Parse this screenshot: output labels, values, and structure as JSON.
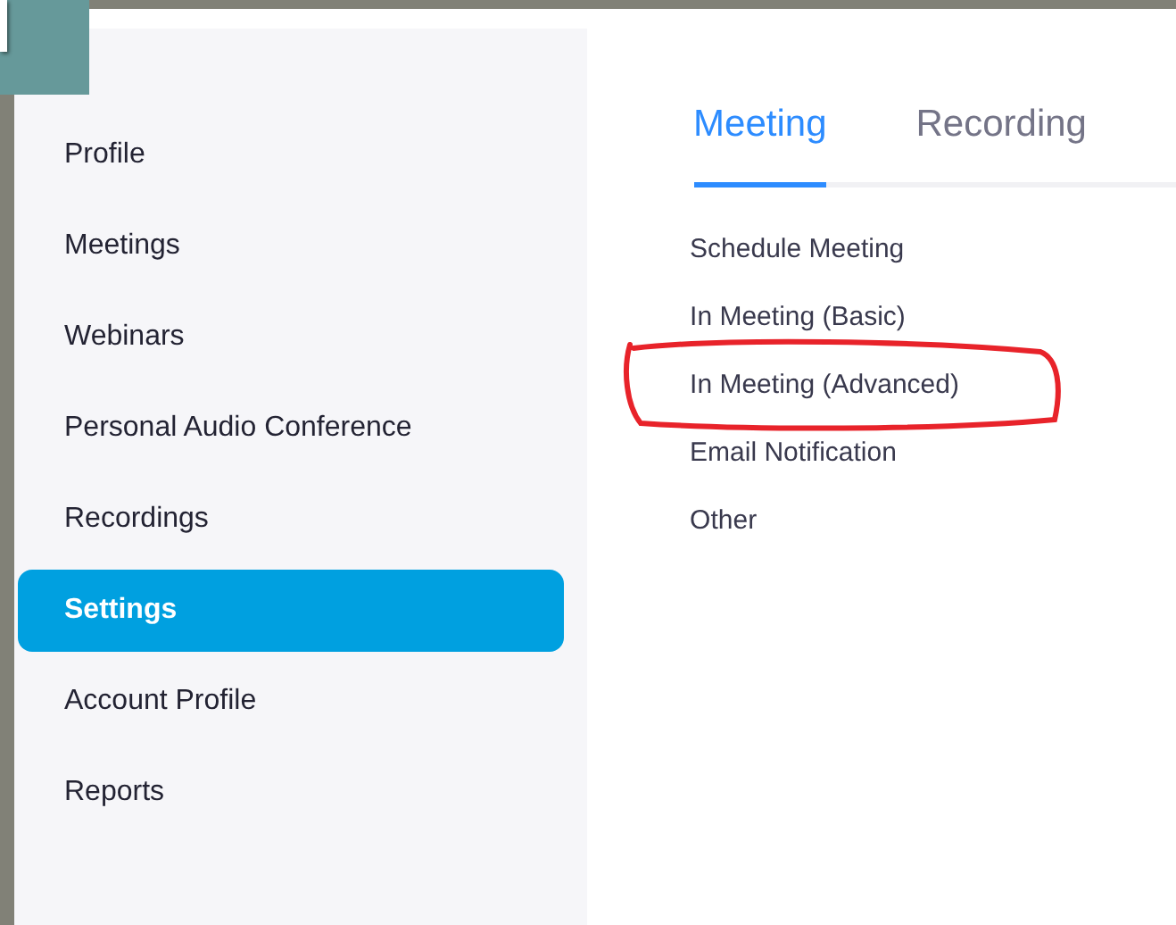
{
  "sidebar": {
    "items": [
      {
        "label": "Profile",
        "selected": false
      },
      {
        "label": "Meetings",
        "selected": false
      },
      {
        "label": "Webinars",
        "selected": false
      },
      {
        "label": "Personal Audio Conference",
        "selected": false
      },
      {
        "label": "Recordings",
        "selected": false
      },
      {
        "label": "Settings",
        "selected": true
      },
      {
        "label": "Account Profile",
        "selected": false
      },
      {
        "label": "Reports",
        "selected": false
      }
    ]
  },
  "tabs": [
    {
      "label": "Meeting",
      "selected": true
    },
    {
      "label": "Recording",
      "selected": false
    }
  ],
  "sections": [
    {
      "label": "Schedule Meeting",
      "circled": false
    },
    {
      "label": "In Meeting (Basic)",
      "circled": false
    },
    {
      "label": "In Meeting (Advanced)",
      "circled": true
    },
    {
      "label": "Email Notification",
      "circled": false
    },
    {
      "label": "Other",
      "circled": false
    }
  ]
}
